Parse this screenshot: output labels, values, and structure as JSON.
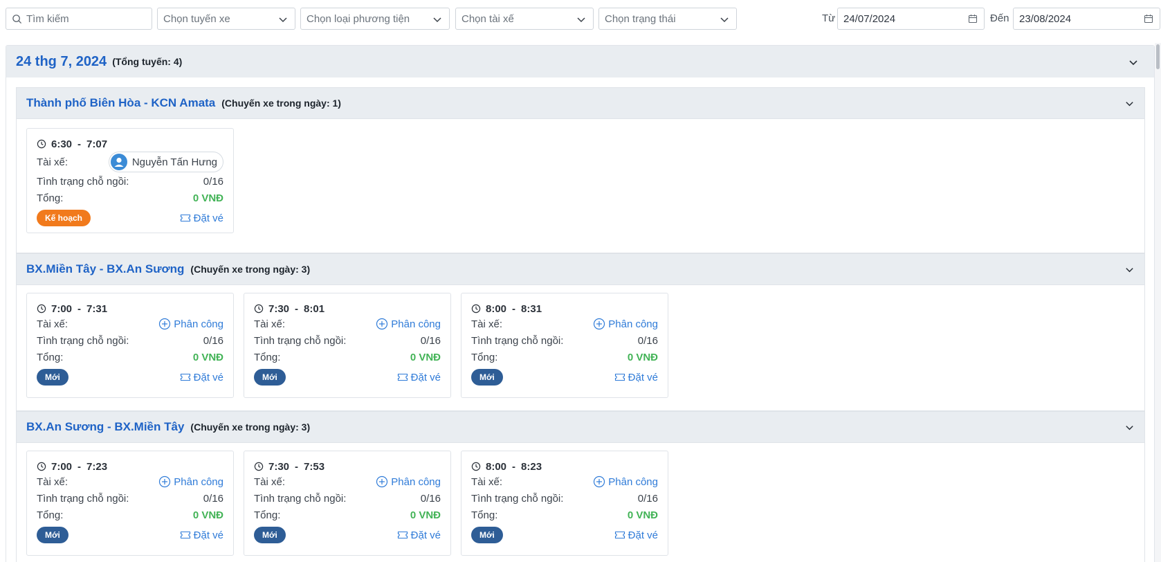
{
  "filters": {
    "search_placeholder": "Tìm kiếm",
    "route_placeholder": "Chọn tuyến xe",
    "vehicle_type_placeholder": "Chọn loại phương tiện",
    "driver_placeholder": "Chọn tài xế",
    "status_placeholder": "Chọn trạng thái",
    "from_label": "Từ",
    "from_date": "24/07/2024",
    "to_label": "Đến",
    "to_date": "23/08/2024"
  },
  "day": {
    "title": "24 thg 7, 2024",
    "count_label": "(Tổng tuyến: 4)"
  },
  "labels": {
    "driver": "Tài xế:",
    "seats": "Tình trạng chỗ ngồi:",
    "total": "Tổng:",
    "assign": "Phân công",
    "book": "Đặt vé"
  },
  "routes": [
    {
      "name": "Thành phố Biên Hòa - KCN Amata",
      "count_label": "(Chuyến xe trong ngày: 1)",
      "trips": [
        {
          "start": "6:30",
          "end": "7:07",
          "driver": "Nguyễn Tấn Hưng",
          "seats": "0/16",
          "total": "0 VNĐ",
          "status": "Kế hoạch"
        }
      ]
    },
    {
      "name": "BX.Miền Tây - BX.An Sương",
      "count_label": "(Chuyến xe trong ngày: 3)",
      "trips": [
        {
          "start": "7:00",
          "end": "7:31",
          "seats": "0/16",
          "total": "0 VNĐ",
          "status": "Mới"
        },
        {
          "start": "7:30",
          "end": "8:01",
          "seats": "0/16",
          "total": "0 VNĐ",
          "status": "Mới"
        },
        {
          "start": "8:00",
          "end": "8:31",
          "seats": "0/16",
          "total": "0 VNĐ",
          "status": "Mới"
        }
      ]
    },
    {
      "name": "BX.An Sương - BX.Miền Tây",
      "count_label": "(Chuyến xe trong ngày: 3)",
      "trips": [
        {
          "start": "7:00",
          "end": "7:23",
          "seats": "0/16",
          "total": "0 VNĐ",
          "status": "Mới"
        },
        {
          "start": "7:30",
          "end": "7:53",
          "seats": "0/16",
          "total": "0 VNĐ",
          "status": "Mới"
        },
        {
          "start": "8:00",
          "end": "8:23",
          "seats": "0/16",
          "total": "0 VNĐ",
          "status": "Mới"
        }
      ]
    }
  ],
  "colors": {
    "route_title": "#1f63c6",
    "total_green": "#42b356",
    "badge_plan": "#f17a1c",
    "badge_new": "#2e5d96",
    "link_blue": "#2f7bd8"
  }
}
